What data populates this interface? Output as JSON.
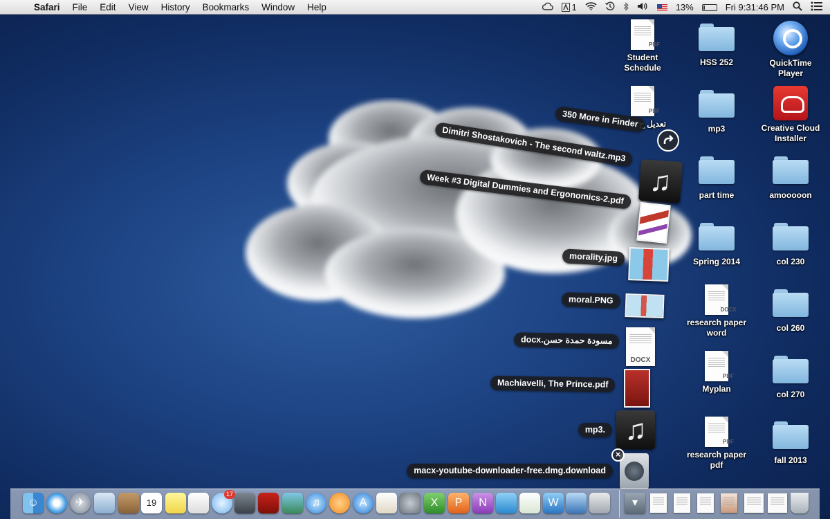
{
  "menubar": {
    "apple_icon": "",
    "app_name": "Safari",
    "menus": [
      "File",
      "Edit",
      "View",
      "History",
      "Bookmarks",
      "Window",
      "Help"
    ],
    "status": {
      "display_number": "1",
      "battery_percent": "13%",
      "battery_level": 0.13,
      "clock": "Fri 9:31:46 PM"
    }
  },
  "desktop": {
    "items": [
      {
        "label": "Student Schedule",
        "icon": "pdf-document-icon",
        "tag": "PDF"
      },
      {
        "label": "HSS 252",
        "icon": "folder-icon"
      },
      {
        "label": "QuickTime Player",
        "icon": "quicktime-icon"
      },
      {
        "label": "تعديل ح",
        "icon": "pdf-document-icon",
        "tag": "PDF"
      },
      {
        "label": "mp3",
        "icon": "folder-icon"
      },
      {
        "label": "Creative Cloud Installer",
        "icon": "creative-cloud-icon"
      },
      {
        "label": "part time",
        "icon": "folder-icon"
      },
      {
        "label": "amooooon",
        "icon": "folder-icon"
      },
      {
        "label": "Spring 2014",
        "icon": "folder-icon"
      },
      {
        "label": "col 230",
        "icon": "folder-icon"
      },
      {
        "label": "research paper word",
        "icon": "docx-document-icon",
        "tag": "DOCX"
      },
      {
        "label": "col 260",
        "icon": "folder-icon"
      },
      {
        "label": "Myplan",
        "icon": "pdf-document-icon",
        "tag": "PDF"
      },
      {
        "label": "col 270",
        "icon": "folder-icon"
      },
      {
        "label": "research paper pdf",
        "icon": "pdf-document-icon",
        "tag": "PDF"
      },
      {
        "label": "fall 2013",
        "icon": "folder-icon"
      }
    ],
    "partial_label": "ت دين"
  },
  "stack": {
    "more_label": "350 More in Finder",
    "items": [
      {
        "label": "Dimitri Shostakovich - The second waltz.mp3",
        "icon": "music-file-icon"
      },
      {
        "label": "Week #3 Digital Dummies and Ergonomics-2.pdf",
        "icon": "pdf-thumbnail-icon"
      },
      {
        "label": "morality.jpg",
        "icon": "image-thumbnail-icon"
      },
      {
        "label": "moral.PNG",
        "icon": "image-thumbnail-icon"
      },
      {
        "label": "docx.مسودة حمدة حسن",
        "icon": "docx-document-icon",
        "tag": "DOCX"
      },
      {
        "label": "Machiavelli, The Prince.pdf",
        "icon": "pdf-thumbnail-icon"
      },
      {
        "label": "mp3.",
        "icon": "music-file-icon"
      },
      {
        "label": "macx-youtube-downloader-free.dmg.download",
        "icon": "download-file-icon"
      }
    ]
  },
  "dock": {
    "calendar_day": "19",
    "messages_badge": "17",
    "apps": [
      "finder-icon",
      "safari-icon",
      "launchpad-icon",
      "preview-icon",
      "contacts-icon",
      "calendar-icon",
      "stickies-icon",
      "reminders-icon",
      "messages-icon",
      "facetime-icon",
      "photo-booth-icon",
      "iphoto-icon",
      "itunes-icon",
      "ibooks-icon",
      "app-store-icon",
      "textedit-icon",
      "system-preferences-icon",
      "excel-icon",
      "powerpoint-icon",
      "onenote-icon",
      "lync-icon",
      "numbers-icon",
      "word-icon",
      "keynote-icon",
      "image-capture-icon",
      "downloads-stack-icon",
      "document-stack-icon",
      "document-stack-icon",
      "document-stack-icon",
      "photo-icon",
      "document-stack-icon",
      "document-stack-icon",
      "trash-icon"
    ]
  }
}
